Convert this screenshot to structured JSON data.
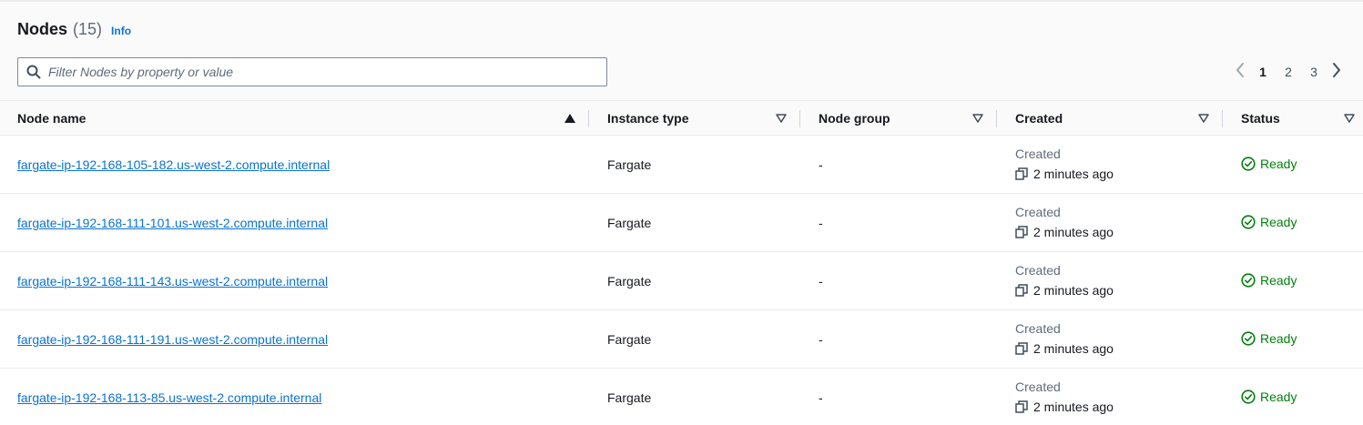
{
  "header": {
    "title": "Nodes",
    "count": "(15)",
    "info_label": "Info"
  },
  "filter": {
    "placeholder": "Filter Nodes by property or value",
    "value": ""
  },
  "pagination": {
    "pages": [
      "1",
      "2",
      "3"
    ],
    "current": "1"
  },
  "table": {
    "columns": [
      "Node name",
      "Instance type",
      "Node group",
      "Created",
      "Status"
    ],
    "sorted_column": "Node name",
    "sort_direction": "ascending",
    "rows": [
      {
        "node_name": "fargate-ip-192-168-105-182.us-west-2.compute.internal",
        "instance_type": "Fargate",
        "node_group": "-",
        "created_label": "Created",
        "created_time": "2 minutes ago",
        "status": "Ready"
      },
      {
        "node_name": "fargate-ip-192-168-111-101.us-west-2.compute.internal",
        "instance_type": "Fargate",
        "node_group": "-",
        "created_label": "Created",
        "created_time": "2 minutes ago",
        "status": "Ready"
      },
      {
        "node_name": "fargate-ip-192-168-111-143.us-west-2.compute.internal",
        "instance_type": "Fargate",
        "node_group": "-",
        "created_label": "Created",
        "created_time": "2 minutes ago",
        "status": "Ready"
      },
      {
        "node_name": "fargate-ip-192-168-111-191.us-west-2.compute.internal",
        "instance_type": "Fargate",
        "node_group": "-",
        "created_label": "Created",
        "created_time": "2 minutes ago",
        "status": "Ready"
      },
      {
        "node_name": "fargate-ip-192-168-113-85.us-west-2.compute.internal",
        "instance_type": "Fargate",
        "node_group": "-",
        "created_label": "Created",
        "created_time": "2 minutes ago",
        "status": "Ready"
      }
    ]
  },
  "colors": {
    "link": "#0972d3",
    "status_ok": "#037f0c",
    "text_secondary": "#5f6b7a"
  },
  "icons": {
    "filter": "search-icon",
    "sort_active": "sort-ascending-icon",
    "sort_inactive": "sort-icon",
    "created": "copy-icon",
    "status": "status-ok-icon",
    "prev": "chevron-left-icon",
    "next": "chevron-right-icon"
  }
}
